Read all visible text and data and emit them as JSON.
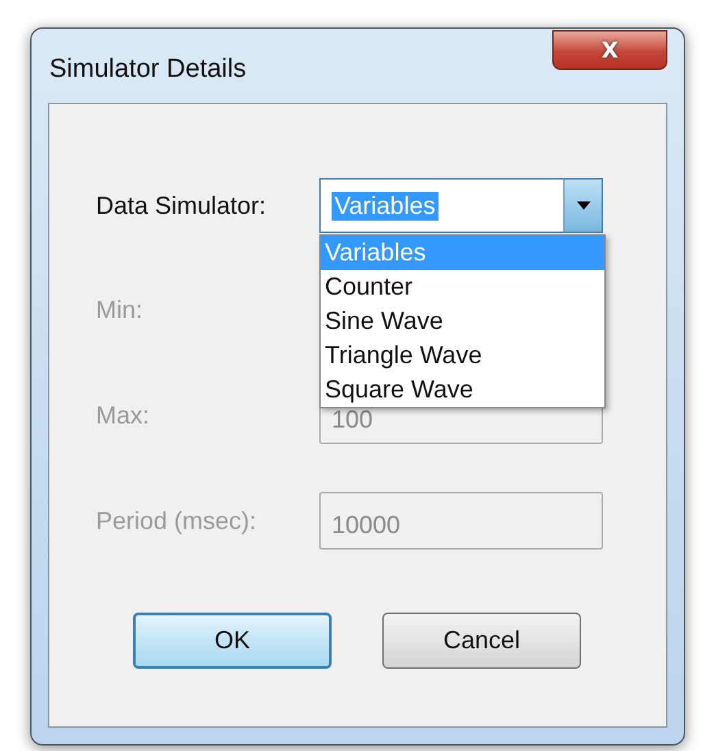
{
  "window": {
    "title": "Simulator Details",
    "close_icon": "X"
  },
  "simulator": {
    "label": "Data Simulator:",
    "value": "Variables",
    "expanded": true,
    "options": [
      {
        "label": "Variables",
        "selected": true
      },
      {
        "label": "Counter",
        "selected": false
      },
      {
        "label": "Sine Wave",
        "selected": false
      },
      {
        "label": "Triangle Wave",
        "selected": false
      },
      {
        "label": "Square Wave",
        "selected": false
      }
    ]
  },
  "fields": [
    {
      "label": "Min:",
      "disabled": true
    },
    {
      "label": "Max:",
      "value": "100",
      "disabled": true
    },
    {
      "label": "Period (msec):",
      "value": "10000",
      "disabled": true
    }
  ],
  "buttons": [
    {
      "label": "OK",
      "default": true
    },
    {
      "label": "Cancel",
      "default": false
    }
  ]
}
